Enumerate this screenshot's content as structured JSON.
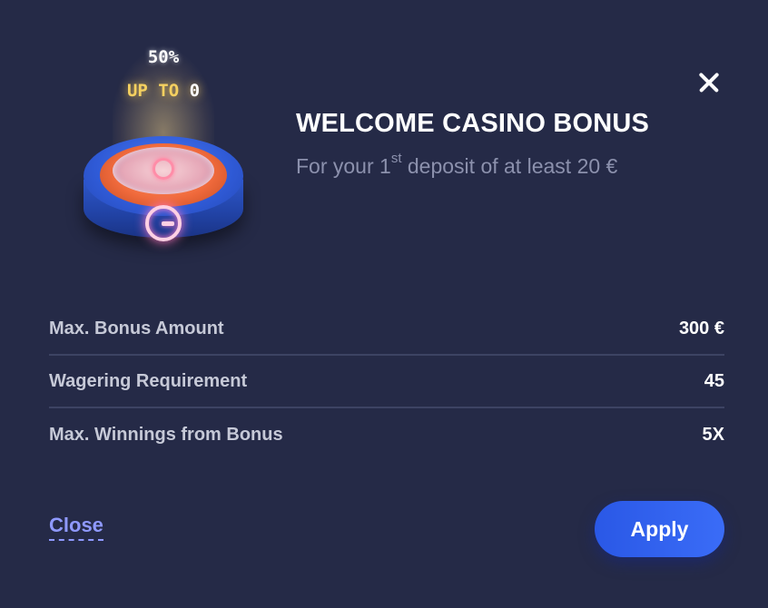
{
  "bonus_badge": {
    "percent": "50%",
    "up_to_text": "UP TO",
    "up_to_amount": "0"
  },
  "header": {
    "title": "WELCOME CASINO BONUS",
    "subtitle_prefix": "For your 1",
    "subtitle_sup": "st",
    "subtitle_suffix": " deposit of at least 20 €"
  },
  "details": [
    {
      "label": "Max. Bonus Amount",
      "value": "300 €"
    },
    {
      "label": "Wagering Requirement",
      "value": "45"
    },
    {
      "label": "Max. Winnings from Bonus",
      "value": "5X"
    }
  ],
  "footer": {
    "close_label": "Close",
    "apply_label": "Apply"
  },
  "colors": {
    "background": "#252a47",
    "accent_blue": "#3a6cf7",
    "link_color": "#8f99ff",
    "gold": "#f4d060"
  }
}
